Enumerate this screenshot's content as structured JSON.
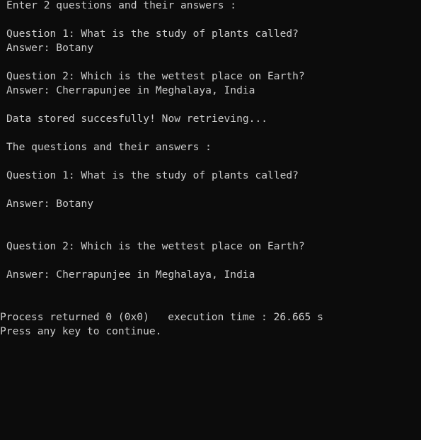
{
  "console": {
    "background": "#0c0c0c",
    "text_color": "#cccccc",
    "lines": [
      "Enter 2 questions and their answers :",
      "",
      "Question 1: What is the study of plants called?",
      "Answer: Botany",
      "",
      "Question 2: Which is the wettest place on Earth?",
      "Answer: Cherrapunjee in Meghalaya, India",
      "",
      "Data stored succesfully! Now retrieving...",
      "",
      "The questions and their answers :",
      "",
      "Question 1: What is the study of plants called?",
      "",
      "Answer: Botany",
      "",
      "",
      "Question 2: Which is the wettest place on Earth?",
      "",
      "Answer: Cherrapunjee in Meghalaya, India",
      "",
      "",
      "Process returned 0 (0x0)   execution time : 26.665 s",
      "Press any key to continue."
    ]
  }
}
